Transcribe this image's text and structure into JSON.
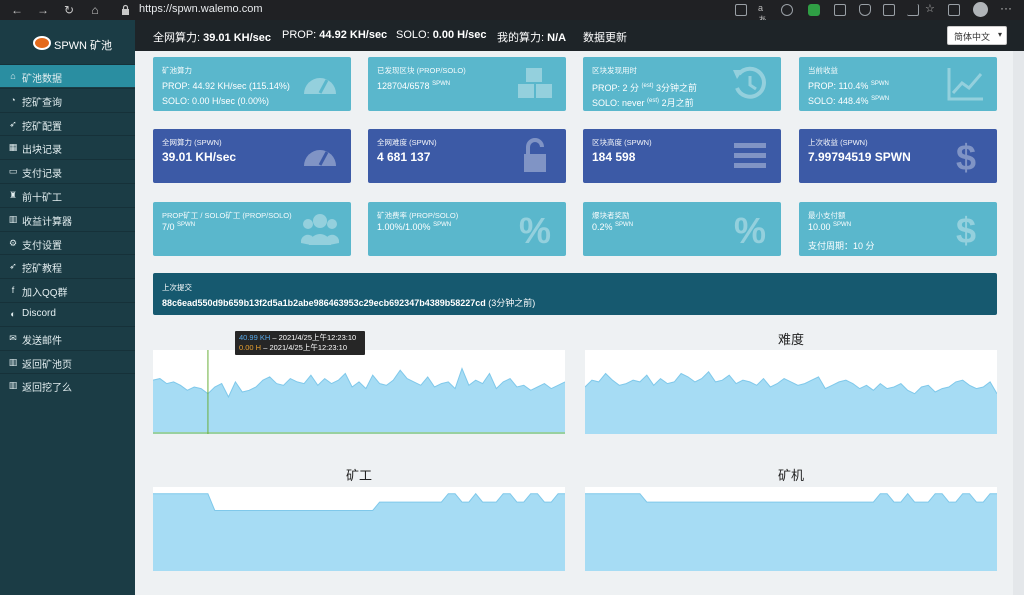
{
  "browser": {
    "url": "https://spwn.walemo.com",
    "buttons": [
      "back",
      "forward",
      "reload",
      "home"
    ]
  },
  "brand": {
    "name": "SPWN 矿池"
  },
  "sidebar": {
    "items": [
      {
        "label": "矿池数据",
        "icon": "home-icon",
        "glyph": "⌂",
        "active": true
      },
      {
        "label": "挖矿查询",
        "icon": "tachometer-icon",
        "glyph": "◔",
        "active": false
      },
      {
        "label": "挖矿配置",
        "icon": "rocket-icon",
        "glyph": "➶",
        "active": false
      },
      {
        "label": "出块记录",
        "icon": "cubes-icon",
        "glyph": "▦",
        "active": false
      },
      {
        "label": "支付记录",
        "icon": "money-icon",
        "glyph": "▭",
        "active": false
      },
      {
        "label": "前十矿工",
        "icon": "trophy-icon",
        "glyph": "♜",
        "active": false
      },
      {
        "label": "收益计算器",
        "icon": "bank-icon",
        "glyph": "▥",
        "active": false
      },
      {
        "label": "支付设置",
        "icon": "cogs-icon",
        "glyph": "⚙",
        "active": false
      },
      {
        "label": "挖矿教程",
        "icon": "rocket-icon",
        "glyph": "➶",
        "active": false
      },
      {
        "label": "加入QQ群",
        "icon": "facebook-icon",
        "glyph": "f",
        "active": false
      },
      {
        "label": "Discord",
        "icon": "discord-icon",
        "glyph": "◐",
        "active": false
      },
      {
        "label": "发送邮件",
        "icon": "envelope-icon",
        "glyph": "✉",
        "active": false
      },
      {
        "label": "返回矿池页",
        "icon": "bank-icon",
        "glyph": "▥",
        "active": false
      },
      {
        "label": "返回挖了么",
        "icon": "bank-icon",
        "glyph": "▥",
        "active": false
      }
    ]
  },
  "header": {
    "network_label": "全网算力:",
    "network_value": "39.01 KH/sec",
    "prop_label": "PROP:",
    "prop_value": "44.92 KH/sec",
    "solo_label": "SOLO:",
    "solo_value": "0.00 H/sec",
    "mine_label": "我的算力:",
    "mine_value": "N/A",
    "update_label": "数据更新",
    "language": "简体中文"
  },
  "cards": {
    "pool_hashrate": {
      "title": "矿池算力",
      "line1": "PROP: 44.92 KH/sec (115.14%)",
      "line2": "SOLO: 0.00 H/sec (0.00%)",
      "icon": "tachometer-icon"
    },
    "blocks_found": {
      "title": "已发现区块 (PROP/SOLO)",
      "value": "128704/6578",
      "unit": "SPWN",
      "icon": "cubes-icon"
    },
    "block_time": {
      "title": "区块发现用时",
      "prop_prefix": "PROP: 2 分",
      "prop_est": "(est)",
      "prop_suffix": "3分钟之前",
      "solo_prefix": "SOLO: never",
      "solo_est": "(est)",
      "solo_suffix": "2月之前",
      "icon": "history-icon"
    },
    "current_profit": {
      "title": "当前收益",
      "prop": "PROP: 110.4%",
      "prop_unit": "SPWN",
      "solo": "SOLO: 448.4%",
      "solo_unit": "SPWN",
      "icon": "line-chart-icon"
    },
    "network_hashrate": {
      "title": "全网算力 (SPWN)",
      "value": "39.01 KH/sec",
      "icon": "tachometer-icon"
    },
    "network_difficulty": {
      "title": "全网难度 (SPWN)",
      "value": "4 681 137",
      "icon": "unlock-icon"
    },
    "block_height": {
      "title": "区块高度 (SPWN)",
      "value": "184 598",
      "icon": "bars-icon"
    },
    "last_reward": {
      "title": "上次收益 (SPWN)",
      "value": "7.99794519 SPWN",
      "icon": "dollar-icon"
    },
    "miners": {
      "title": "PROP矿工 / SOLO矿工 (PROP/SOLO)",
      "value": "7/0",
      "unit": "SPWN",
      "icon": "users-icon"
    },
    "pool_fee": {
      "title": "矿池费率 (PROP/SOLO)",
      "value": "1.00%/1.00%",
      "unit": "SPWN",
      "icon": "percent-icon"
    },
    "finder_reward": {
      "title": "爆块者奖励",
      "value": "0.2%",
      "unit": "SPWN",
      "icon": "percent-icon"
    },
    "min_payout": {
      "title": "最小支付额",
      "value": "10.00",
      "unit": "SPWN",
      "period": "支付周期：10 分",
      "icon": "dollar-icon"
    }
  },
  "last_share": {
    "title": "上次提交",
    "hash": "88c6ead550d9b659b13f2d5a1b2abe986463953c29ecb692347b4389b58227cd",
    "ago": "(3分钟之前)"
  },
  "charts": {
    "hashrate_title": "力",
    "difficulty_title": "难度",
    "miners_title": "矿工",
    "workers_title": "矿机"
  },
  "tooltip": {
    "line1_value": "40.99 KH",
    "line1_rest": " – 2021/4/25上午12:23:10",
    "line2_value": "0.00 H",
    "line2_rest": " – 2021/4/25上午12:23:10"
  },
  "chart_data": [
    {
      "type": "area",
      "name": "hashrate",
      "ylim": [
        0,
        100
      ],
      "values": [
        64,
        66,
        60,
        62,
        58,
        52,
        56,
        54,
        48,
        56,
        60,
        44,
        62,
        50,
        52,
        56,
        64,
        68,
        60,
        58,
        66,
        62,
        60,
        70,
        58,
        66,
        60,
        64,
        72,
        56,
        62,
        54,
        70,
        60,
        58,
        64,
        76,
        66,
        62,
        58,
        68,
        56,
        60,
        62,
        54,
        78,
        58,
        64,
        60,
        72,
        54,
        62,
        66,
        56,
        58,
        52,
        56,
        60,
        54,
        58,
        62
      ]
    },
    {
      "type": "area",
      "name": "difficulty",
      "ylim": [
        0,
        100
      ],
      "values": [
        56,
        64,
        62,
        72,
        64,
        58,
        60,
        64,
        62,
        70,
        58,
        66,
        60,
        62,
        72,
        68,
        62,
        66,
        74,
        62,
        64,
        70,
        60,
        64,
        62,
        58,
        66,
        56,
        60,
        66,
        62,
        58,
        60,
        64,
        68,
        54,
        58,
        62,
        64,
        60,
        54,
        58,
        52,
        60,
        54,
        56,
        60,
        52,
        48,
        56,
        58,
        50,
        54,
        56,
        62,
        64,
        58,
        54,
        56,
        62,
        48
      ]
    },
    {
      "type": "area",
      "name": "miners",
      "ylim": [
        0,
        100
      ],
      "values": [
        92,
        92,
        92,
        92,
        92,
        92,
        92,
        92,
        92,
        72,
        72,
        72,
        72,
        72,
        72,
        72,
        72,
        72,
        72,
        72,
        72,
        72,
        72,
        72,
        72,
        72,
        72,
        72,
        72,
        72,
        72,
        72,
        72,
        82,
        82,
        82,
        82,
        82,
        82,
        82,
        82,
        82,
        82,
        92,
        92,
        82,
        82,
        92,
        82,
        82,
        82,
        92,
        92,
        82,
        82,
        92,
        92,
        82,
        82,
        92,
        92
      ]
    },
    {
      "type": "area",
      "name": "workers",
      "ylim": [
        0,
        100
      ],
      "values": [
        92,
        92,
        92,
        92,
        92,
        92,
        92,
        92,
        92,
        82,
        82,
        82,
        82,
        82,
        82,
        82,
        82,
        82,
        82,
        82,
        82,
        82,
        82,
        82,
        82,
        82,
        82,
        82,
        82,
        82,
        82,
        82,
        82,
        82,
        82,
        82,
        82,
        82,
        82,
        82,
        82,
        82,
        82,
        92,
        92,
        82,
        82,
        92,
        82,
        82,
        82,
        92,
        92,
        82,
        82,
        92,
        92,
        82,
        82,
        92,
        92
      ]
    }
  ]
}
